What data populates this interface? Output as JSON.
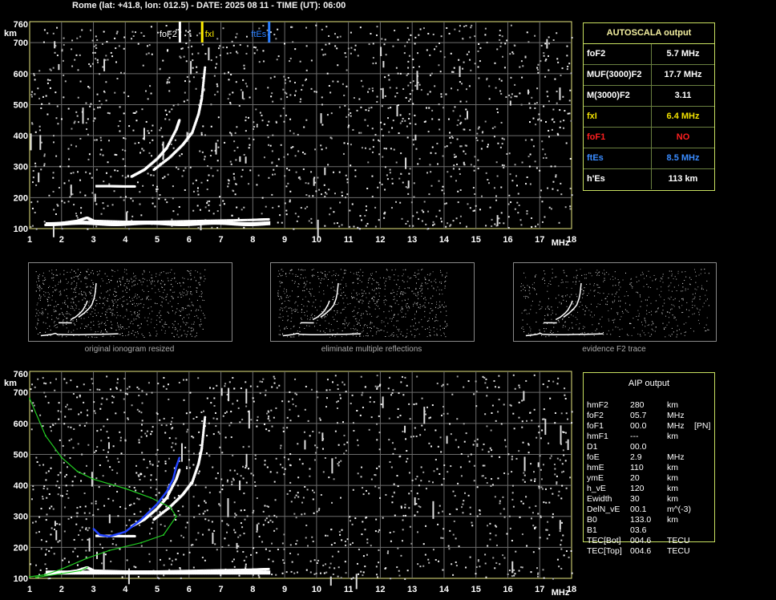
{
  "header": {
    "title": "Rome (lat: +41.8, lon: 012.5) - DATE: 2025 08 11 - TIME (UT): 06:00"
  },
  "top_chart": {
    "y_unit": "km",
    "x_unit": "MHz",
    "y_ticks": [
      "760",
      "700",
      "600",
      "500",
      "400",
      "300",
      "200",
      "100"
    ],
    "x_ticks": [
      "1",
      "2",
      "3",
      "4",
      "5",
      "6",
      "7",
      "8",
      "9",
      "10",
      "11",
      "12",
      "13",
      "14",
      "15",
      "16",
      "17",
      "18"
    ],
    "markers": [
      {
        "label": "foF2",
        "freq": 5.7,
        "color": "#ffffff"
      },
      {
        "label": "fxI",
        "freq": 6.4,
        "color": "#ffee00"
      },
      {
        "label": "ftEs",
        "freq": 8.5,
        "color": "#2a7fff"
      }
    ]
  },
  "autoscala": {
    "title": "AUTOSCALA output",
    "rows": [
      {
        "key": "foF2",
        "value": "5.7 MHz",
        "key_color": "#ffffff",
        "value_color": "#ffffff"
      },
      {
        "key": "MUF(3000)F2",
        "value": "17.7 MHz",
        "key_color": "#ffffff",
        "value_color": "#ffffff"
      },
      {
        "key": "M(3000)F2",
        "value": "3.11",
        "key_color": "#ffffff",
        "value_color": "#ffffff"
      },
      {
        "key": "fxI",
        "value": "6.4 MHz",
        "key_color": "#f0e000",
        "value_color": "#f0e000"
      },
      {
        "key": "foF1",
        "value": "NO",
        "key_color": "#ff2020",
        "value_color": "#ff2020"
      },
      {
        "key": "ftEs",
        "value": "8.5 MHz",
        "key_color": "#3a8cff",
        "value_color": "#3a8cff"
      },
      {
        "key": "h'Es",
        "value": "113    km",
        "key_color": "#ffffff",
        "value_color": "#ffffff"
      }
    ]
  },
  "thumbnails": [
    {
      "caption": "original ionogram resized"
    },
    {
      "caption": "eliminate multiple reflections"
    },
    {
      "caption": "evidence F2 trace"
    }
  ],
  "bottom_chart": {
    "y_unit": "km",
    "x_unit": "MHz",
    "y_ticks": [
      "760",
      "700",
      "600",
      "500",
      "400",
      "300",
      "200",
      "100"
    ],
    "x_ticks": [
      "1",
      "2",
      "3",
      "4",
      "5",
      "6",
      "7",
      "8",
      "9",
      "10",
      "11",
      "12",
      "13",
      "14",
      "15",
      "16",
      "17",
      "18"
    ]
  },
  "aip": {
    "title": "AIP output",
    "rows": [
      {
        "name": "hmF2",
        "value": "280",
        "unit": "km",
        "extra": ""
      },
      {
        "name": "foF2",
        "value": "05.7",
        "unit": "MHz",
        "extra": ""
      },
      {
        "name": "foF1",
        "value": "00.0",
        "unit": "MHz",
        "extra": "[PN]"
      },
      {
        "name": "hmF1",
        "value": "---",
        "unit": "km",
        "extra": ""
      },
      {
        "name": "D1",
        "value": "00.0",
        "unit": "",
        "extra": ""
      },
      {
        "name": "foE",
        "value": "2.9",
        "unit": "MHz",
        "extra": ""
      },
      {
        "name": "hmE",
        "value": "110",
        "unit": "km",
        "extra": ""
      },
      {
        "name": "ymE",
        "value": "20",
        "unit": "km",
        "extra": ""
      },
      {
        "name": "h_vE",
        "value": "120",
        "unit": "km",
        "extra": ""
      },
      {
        "name": "Ewidth",
        "value": "30",
        "unit": "km",
        "extra": ""
      },
      {
        "name": "DelN_vE",
        "value": "00.1",
        "unit": "m^(-3)",
        "extra": ""
      },
      {
        "name": "B0",
        "value": "133.0",
        "unit": "km",
        "extra": ""
      },
      {
        "name": "B1",
        "value": "03.6",
        "unit": "",
        "extra": ""
      },
      {
        "name": "TEC[Bot]",
        "value": "004.6",
        "unit": "TECU",
        "extra": ""
      },
      {
        "name": "TEC[Top]",
        "value": "004.6",
        "unit": "TECU",
        "extra": ""
      }
    ]
  },
  "chart_data": [
    {
      "type": "scatter",
      "title": "",
      "xlabel": "MHz",
      "ylabel": "km",
      "xlim": [
        1,
        18
      ],
      "ylim": [
        100,
        760
      ],
      "grid": true,
      "series": [
        {
          "values": [
            [
              1.5,
              112
            ],
            [
              2.0,
              118
            ],
            [
              2.5,
              125
            ],
            [
              2.8,
              135
            ],
            [
              3.0,
              125
            ],
            [
              4,
              122
            ],
            [
              5,
              122
            ],
            [
              6,
              124
            ],
            [
              7,
              126
            ],
            [
              8,
              128
            ],
            [
              8.5,
              130
            ]
          ]
        },
        {
          "values": [
            [
              3.1,
              237
            ],
            [
              3.5,
              237
            ],
            [
              4.0,
              236
            ],
            [
              4.3,
              236
            ]
          ]
        },
        {
          "values": [
            [
              4.2,
              268
            ],
            [
              4.6,
              290
            ],
            [
              5.0,
              325
            ],
            [
              5.3,
              360
            ],
            [
              5.6,
              420
            ],
            [
              5.7,
              450
            ]
          ]
        },
        {
          "values": [
            [
              4.9,
              290
            ],
            [
              5.4,
              330
            ],
            [
              5.8,
              370
            ],
            [
              6.1,
              410
            ],
            [
              6.3,
              470
            ],
            [
              6.4,
              520
            ],
            [
              6.5,
              620
            ]
          ]
        }
      ]
    },
    {
      "type": "line",
      "title": "",
      "xlabel": "MHz",
      "ylabel": "km",
      "xlim": [
        1,
        18
      ],
      "ylim": [
        100,
        760
      ],
      "grid": true,
      "series": [
        {
          "values": [
            [
              1.0,
              680
            ],
            [
              1.5,
              560
            ],
            [
              2.0,
              490
            ],
            [
              2.5,
              445
            ],
            [
              3.0,
              420
            ],
            [
              4.0,
              390
            ],
            [
              4.8,
              360
            ],
            [
              5.4,
              330
            ],
            [
              5.6,
              300
            ],
            [
              5.2,
              240
            ],
            [
              4.5,
              215
            ],
            [
              3.5,
              190
            ],
            [
              2.8,
              165
            ],
            [
              2.0,
              130
            ],
            [
              1.5,
              112
            ],
            [
              1.0,
              105
            ]
          ]
        },
        {
          "values": [
            [
              3.0,
              260
            ],
            [
              3.2,
              240
            ],
            [
              3.5,
              235
            ],
            [
              4.0,
              250
            ],
            [
              4.5,
              290
            ],
            [
              5.0,
              340
            ],
            [
              5.3,
              380
            ],
            [
              5.5,
              420
            ],
            [
              5.6,
              460
            ],
            [
              5.7,
              490
            ]
          ]
        },
        {
          "values": [
            [
              1.2,
              103
            ],
            [
              2.0,
              115
            ],
            [
              2.6,
              125
            ],
            [
              2.8,
              135
            ]
          ]
        }
      ]
    }
  ]
}
